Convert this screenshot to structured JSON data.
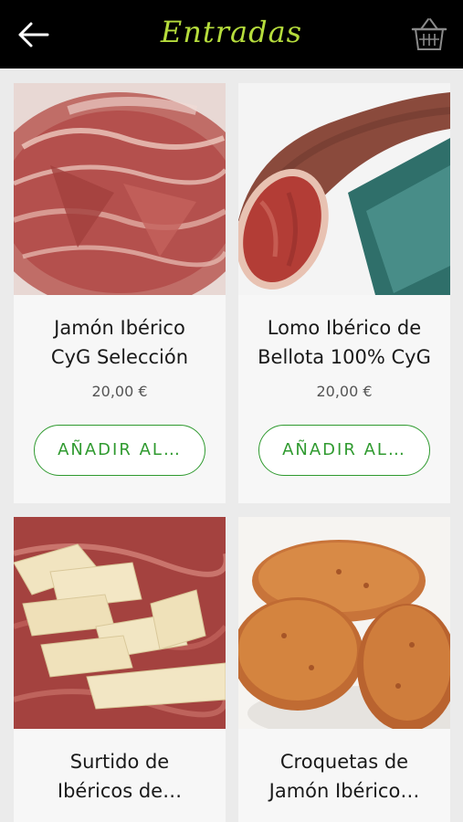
{
  "header": {
    "title": "Entradas",
    "back_icon": "arrow-left-icon",
    "cart_icon": "basket-icon",
    "background": "#000000",
    "title_color": "#b6dd3c"
  },
  "accent_color": "#2f9a2f",
  "products": [
    {
      "name_line1": "Jamón Ibérico",
      "name_line2": "CyG Selección",
      "price": "20,00 €",
      "button_label": "AÑADIR AL…",
      "image": "sliced-ham-photo"
    },
    {
      "name_line1": "Lomo Ibérico de",
      "name_line2": "Bellota 100% CyG",
      "price": "20,00 €",
      "button_label": "AÑADIR AL…",
      "image": "cured-loin-photo"
    },
    {
      "name_line1": "Surtido de",
      "name_line2": "Ibéricos de…",
      "price": "",
      "button_label": "",
      "image": "iberian-assortment-photo"
    },
    {
      "name_line1": "Croquetas de",
      "name_line2": "Jamón Ibérico…",
      "price": "",
      "button_label": "",
      "image": "croquettes-photo"
    }
  ]
}
